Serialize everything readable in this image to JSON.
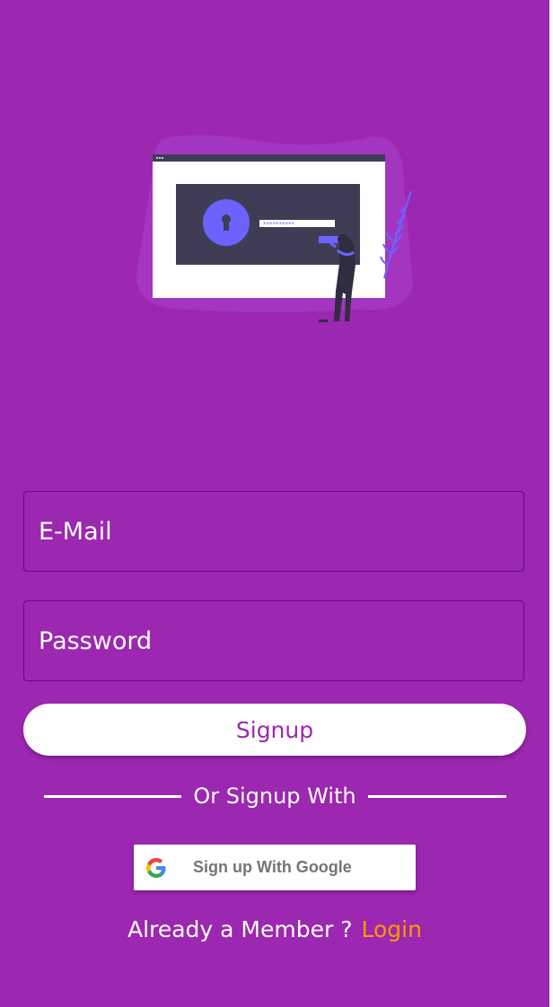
{
  "form": {
    "email_placeholder": "E-Mail",
    "password_placeholder": "Password",
    "signup_label": "Signup"
  },
  "divider": {
    "text": "Or Signup With"
  },
  "google": {
    "label": "Sign up With Google",
    "icon": "google-g-icon"
  },
  "footer": {
    "prompt": "Already a Member ?",
    "login_label": "Login"
  },
  "colors": {
    "background": "#9c27b0",
    "accent": "#ff9800",
    "illustration_accent": "#6c63ff"
  }
}
